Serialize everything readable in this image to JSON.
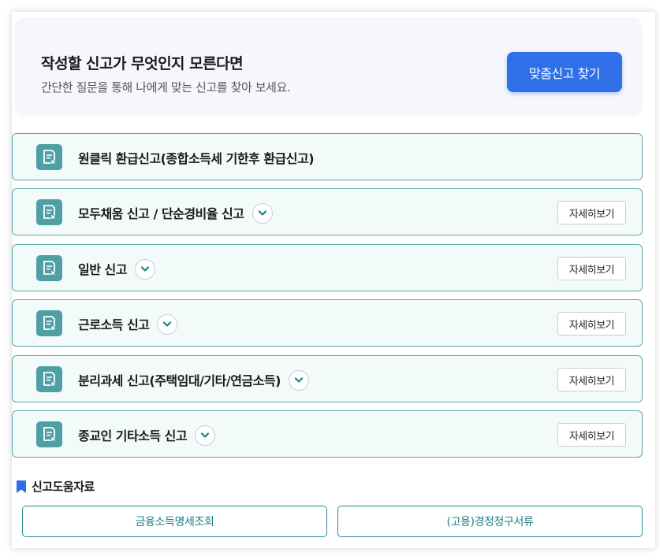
{
  "guide": {
    "title": "작성할 신고가 무엇인지 모른다면",
    "subtitle": "간단한 질문을 통해 나에게 맞는 신고를 찾아 보세요.",
    "button_label": "맞춤신고 찾기"
  },
  "rows": [
    {
      "label": "원클릭 환급신고(종합소득세 기한후 환급신고)",
      "has_chevron": false,
      "detail_label": ""
    },
    {
      "label": "모두채움 신고 / 단순경비율 신고",
      "has_chevron": true,
      "detail_label": "자세히보기"
    },
    {
      "label": "일반 신고",
      "has_chevron": true,
      "detail_label": "자세히보기"
    },
    {
      "label": "근로소득 신고",
      "has_chevron": true,
      "detail_label": "자세히보기"
    },
    {
      "label": "분리과세 신고(주택임대/기타/연금소득)",
      "has_chevron": true,
      "detail_label": "자세히보기"
    },
    {
      "label": "종교인 기타소득 신고",
      "has_chevron": true,
      "detail_label": "자세히보기"
    }
  ],
  "icons": {
    "row_icon": "document-play-icon",
    "chevron": "chevron-down-icon",
    "bookmark": "bookmark-icon"
  },
  "help": {
    "title": "신고도움자료",
    "buttons": [
      "금융소득명세조회",
      "(고용)경정청구서류"
    ]
  },
  "colors": {
    "primary": "#2f6fe8",
    "teal": "#4fa0a6",
    "teal_border": "#5fa7ad",
    "row_bg": "#f3fafa",
    "guide_bg": "#f5f7fc"
  }
}
